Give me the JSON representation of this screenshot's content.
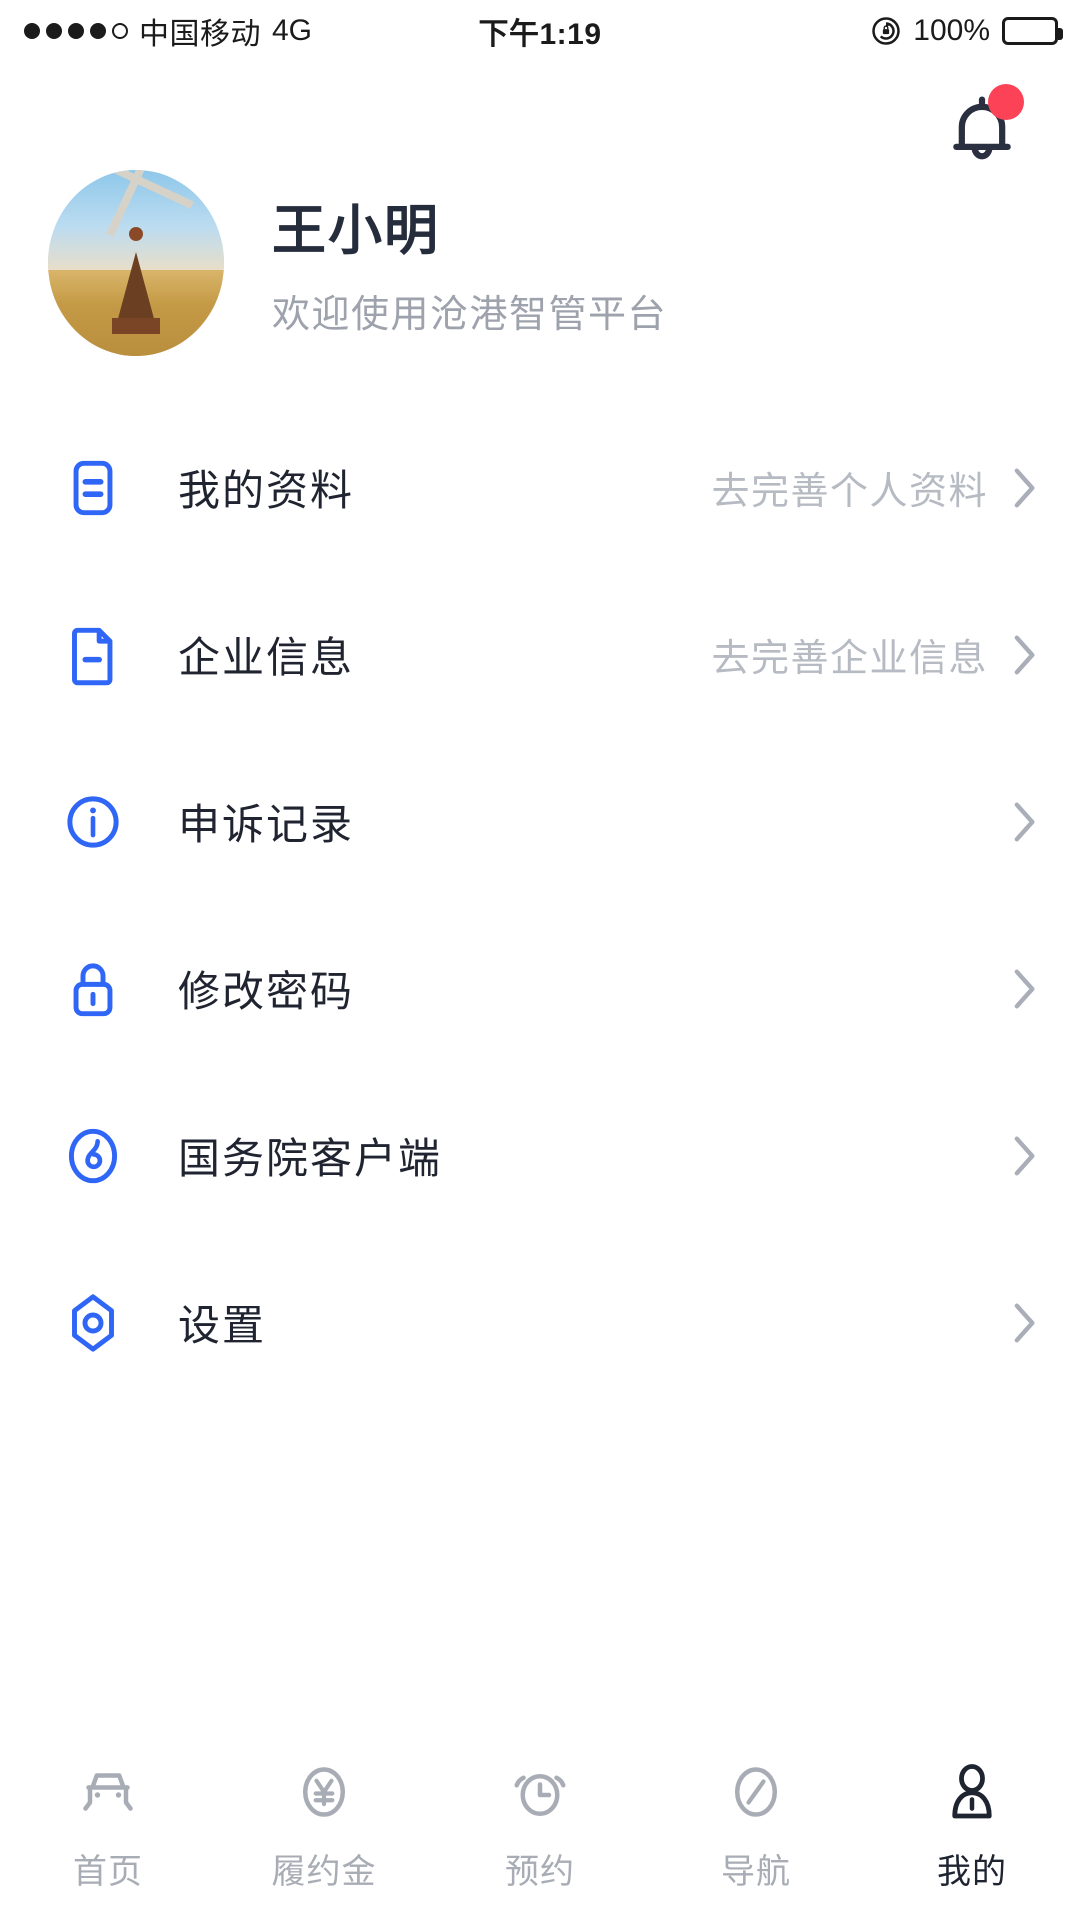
{
  "status_bar": {
    "signal_dots_filled": 4,
    "signal_dots_total": 5,
    "carrier": "中国移动",
    "network": "4G",
    "time": "下午1:19",
    "battery_percent": "100%",
    "rotation_lock_icon": "rotation-lock-icon",
    "battery_icon": "battery-full-icon"
  },
  "header": {
    "notification_icon": "bell-icon",
    "has_notification_badge": true,
    "badge_color": "#FB4257"
  },
  "profile": {
    "avatar_icon": "avatar-photo-windmill",
    "name": "王小明",
    "welcome": "欢迎使用沧港智管平台"
  },
  "menu": {
    "accent_color": "#2F66F6",
    "items": [
      {
        "icon": "document-lines-icon",
        "label": "我的资料",
        "hint": "去完善个人资料",
        "chevron": "chevron-right-icon"
      },
      {
        "icon": "file-minus-icon",
        "label": "企业信息",
        "hint": "去完善企业信息",
        "chevron": "chevron-right-icon"
      },
      {
        "icon": "info-circle-icon",
        "label": "申诉记录",
        "hint": "",
        "chevron": "chevron-right-icon"
      },
      {
        "icon": "lock-icon",
        "label": "修改密码",
        "hint": "",
        "chevron": "chevron-right-icon"
      },
      {
        "icon": "state-council-swirl-icon",
        "label": "国务院客户端",
        "hint": "",
        "chevron": "chevron-right-icon"
      },
      {
        "icon": "settings-hexagon-icon",
        "label": "设置",
        "hint": "",
        "chevron": "chevron-right-icon"
      }
    ]
  },
  "tabbar": {
    "active_index": 4,
    "active_color": "#1E2430",
    "inactive_color": "#A8ACB5",
    "items": [
      {
        "icon": "car-icon",
        "label": "首页"
      },
      {
        "icon": "yen-circle-icon",
        "label": "履约金"
      },
      {
        "icon": "alarm-clock-icon",
        "label": "预约"
      },
      {
        "icon": "compass-icon",
        "label": "导航"
      },
      {
        "icon": "person-icon",
        "label": "我的"
      }
    ]
  }
}
